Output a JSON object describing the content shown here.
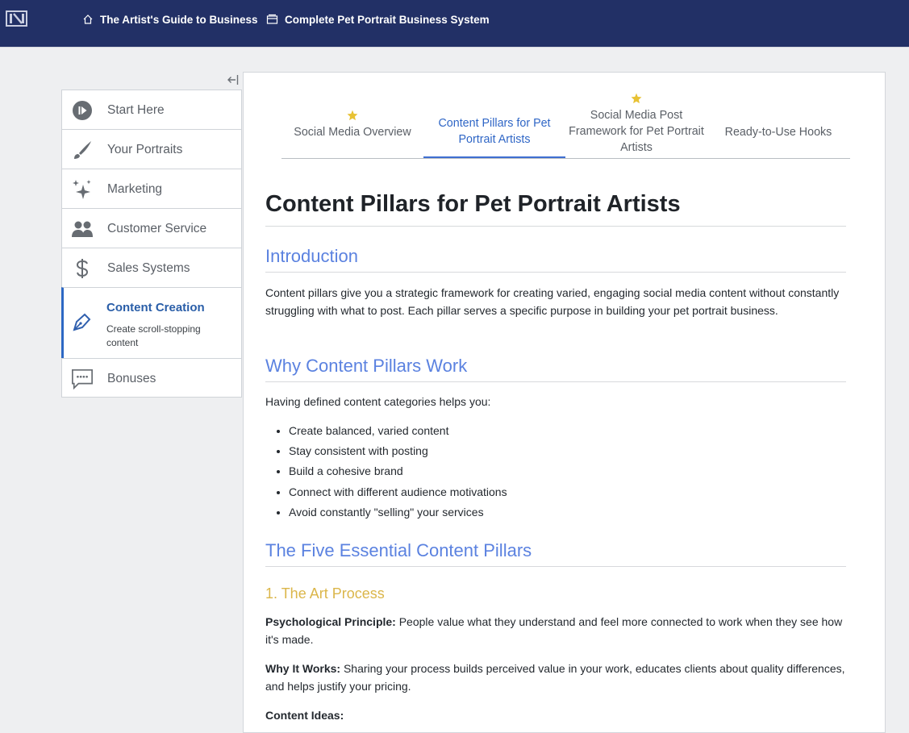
{
  "header": {
    "breadcrumbs": [
      {
        "label": "The Artist's Guide to Business",
        "icon": "home-icon"
      },
      {
        "label": "Complete Pet Portrait Business System",
        "icon": "envelope-icon"
      }
    ]
  },
  "sidebar": {
    "items": [
      {
        "label": "Start Here",
        "icon": "play-icon"
      },
      {
        "label": "Your Portraits",
        "icon": "brush-icon"
      },
      {
        "label": "Marketing",
        "icon": "sparkle-icon"
      },
      {
        "label": "Customer Service",
        "icon": "people-icon"
      },
      {
        "label": "Sales Systems",
        "icon": "dollar-icon"
      },
      {
        "label": "Content Creation",
        "sublabel": "Create scroll-stopping content",
        "icon": "pen-icon",
        "active": true
      },
      {
        "label": "Bonuses",
        "icon": "chat-icon"
      }
    ]
  },
  "tabs": [
    {
      "label": "Social Media Overview",
      "starred": true
    },
    {
      "label": "Content Pillars for Pet Portrait Artists",
      "active": true
    },
    {
      "label": "Social Media Post Framework for Pet Portrait Artists",
      "starred": true
    },
    {
      "label": "Ready-to-Use Hooks"
    }
  ],
  "article": {
    "title": "Content Pillars for Pet Portrait Artists",
    "intro_heading": "Introduction",
    "intro_text": "Content pillars give you a strategic framework for creating varied, engaging social media content without constantly struggling with what to post. Each pillar serves a specific purpose in building your pet portrait business.",
    "why_heading": "Why Content Pillars Work",
    "why_text": "Having defined content categories helps you:",
    "why_items": [
      "Create balanced, varied content",
      "Stay consistent with posting",
      "Build a cohesive brand",
      "Connect with different audience motivations",
      "Avoid constantly \"selling\" your services"
    ],
    "five_heading": "The Five Essential Content Pillars",
    "pillar1_heading": "1. The Art Process",
    "principle_label": "Psychological Principle:",
    "principle_text": " People value what they understand and feel more connected to work when they see how it's made.",
    "why_works_label": "Why It Works:",
    "why_works_text": " Sharing your process builds perceived value in your work, educates clients about quality differences, and helps justify your pricing.",
    "ideas_label": "Content Ideas:"
  },
  "colors": {
    "topbar": "#223066",
    "accent": "#2f66c6",
    "h2": "#5b82e0",
    "h3": "#dbb64a",
    "star": "#e8c234"
  }
}
